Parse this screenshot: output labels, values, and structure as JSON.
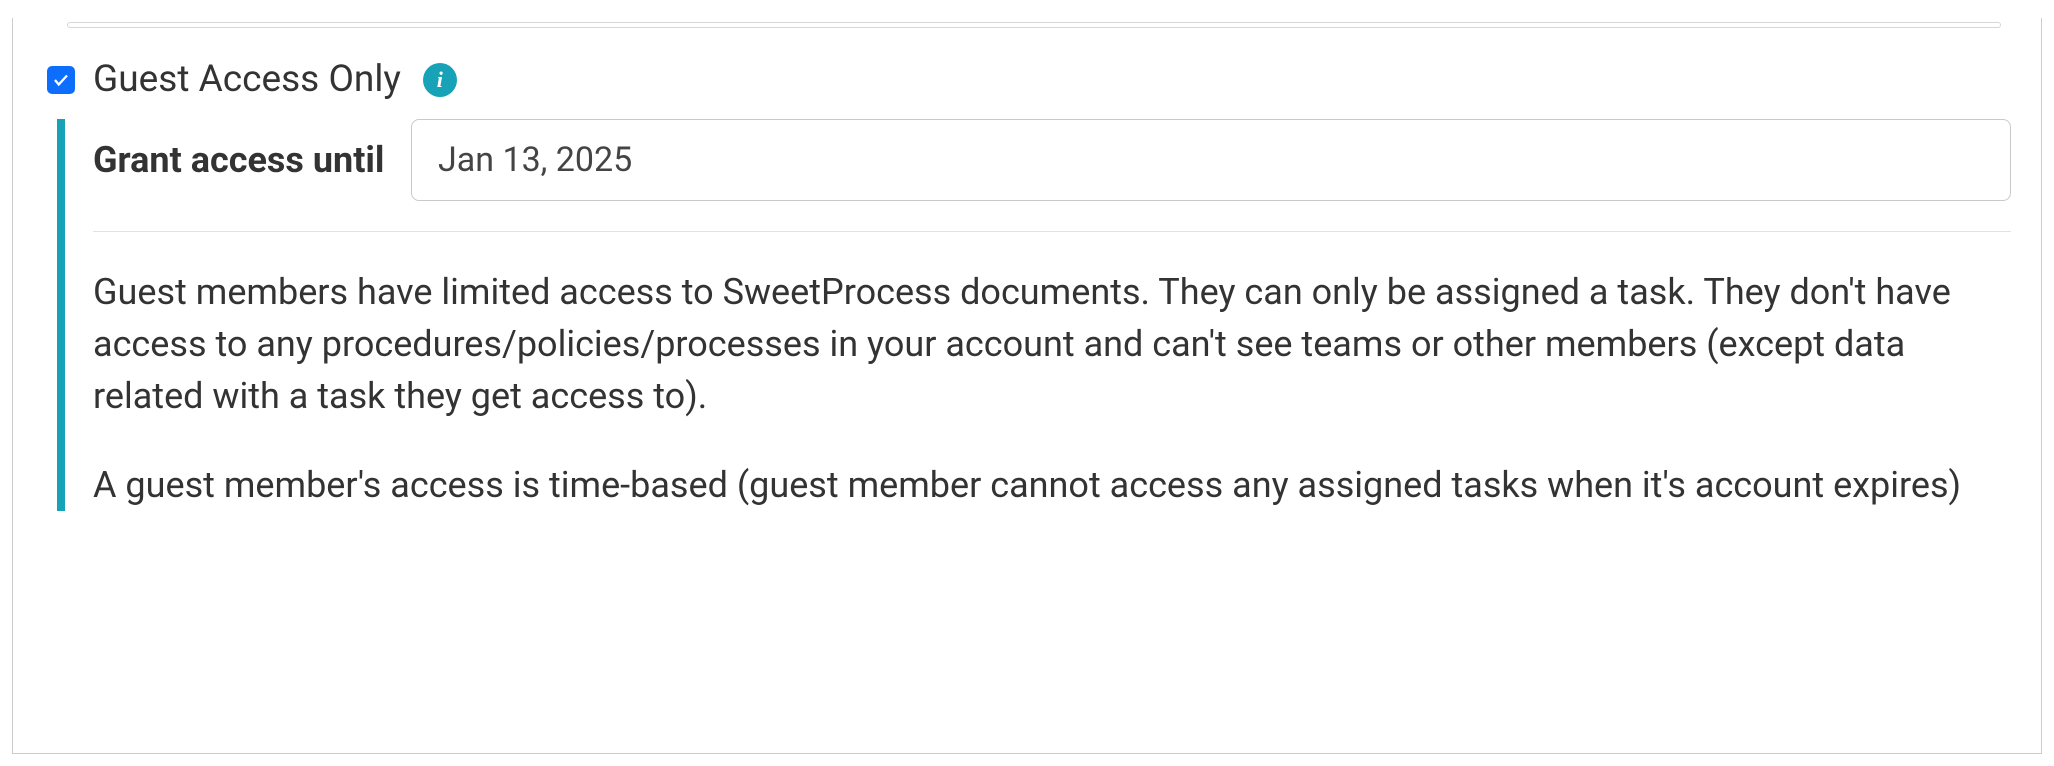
{
  "guestAccess": {
    "checkboxLabel": "Guest Access Only",
    "infoIcon": "i",
    "grantLabel": "Grant access until",
    "dateValue": "Jan 13, 2025",
    "description1": "Guest members have limited access to SweetProcess documents. They can only be assigned a task. They don't have access to any procedures/policies/processes in your account and can't see teams or other members (except data related with a task they get access to).",
    "description2": "A guest member's access is time-based (guest member cannot access any assigned tasks when it's account expires)"
  }
}
